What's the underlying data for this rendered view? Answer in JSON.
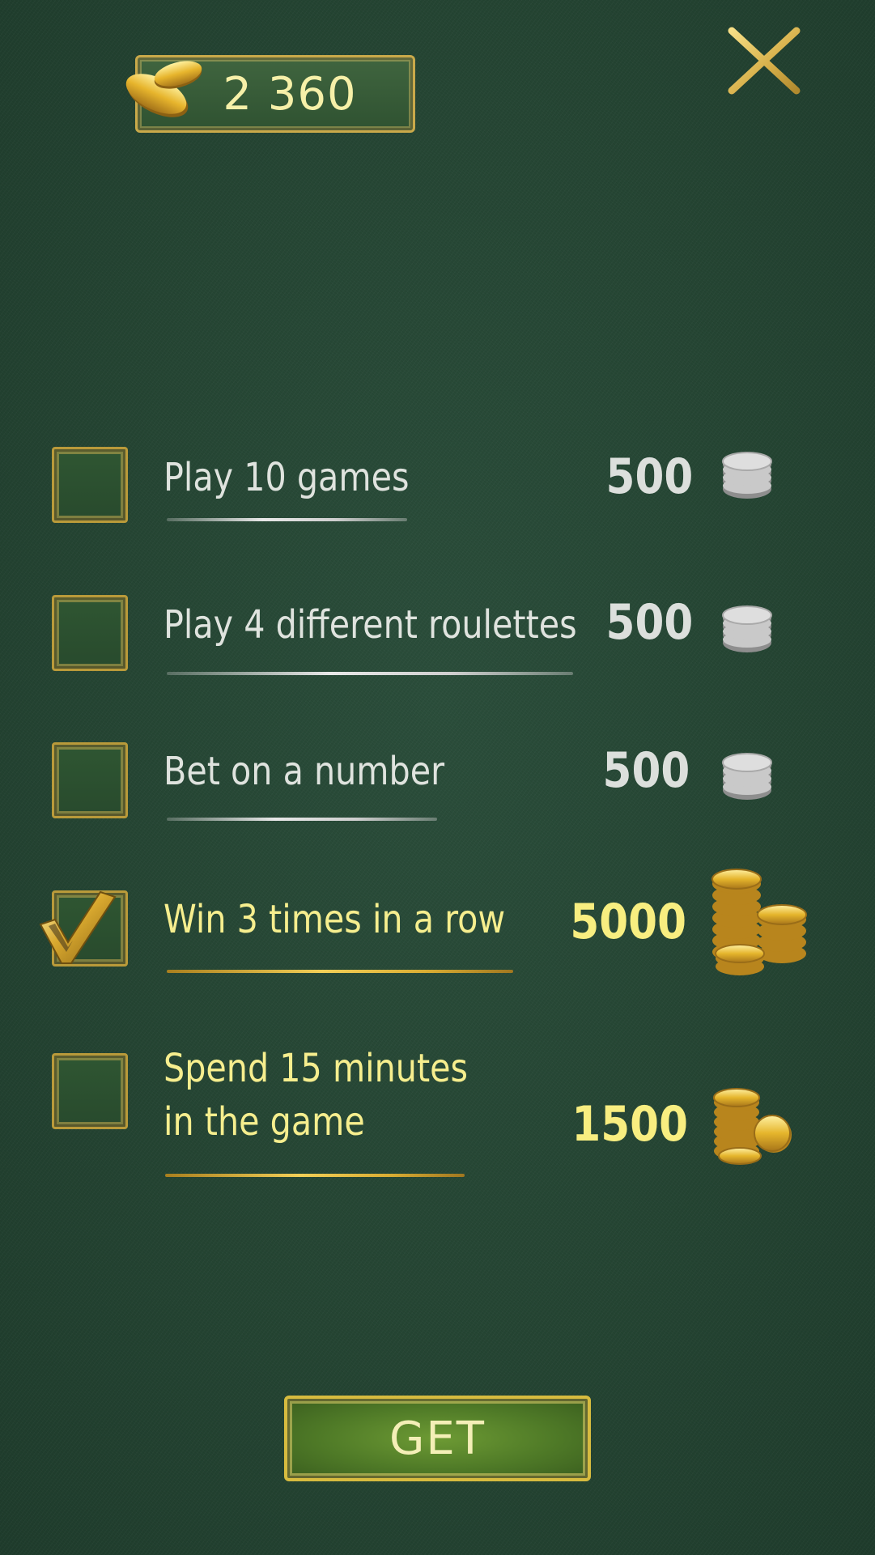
{
  "balance": {
    "value": "2 360",
    "icon": "gold-coins-icon"
  },
  "close": {
    "icon": "close-icon"
  },
  "quests": [
    {
      "label": "Play 10 games",
      "reward": "500",
      "reward_type": "silver",
      "completed": false
    },
    {
      "label": "Play 4 different roulettes",
      "reward": "500",
      "reward_type": "silver",
      "completed": false
    },
    {
      "label": "Bet on a number",
      "reward": "500",
      "reward_type": "silver",
      "completed": false
    },
    {
      "label": "Win 3 times in a row",
      "reward": "5000",
      "reward_type": "gold",
      "completed": true
    },
    {
      "label_line1": "Spend 15 minutes",
      "label_line2": "in the game",
      "reward": "1500",
      "reward_type": "gold",
      "completed": false
    }
  ],
  "get_button": {
    "label": "GET"
  },
  "colors": {
    "felt": "#274836",
    "gold": "#d7bb3f",
    "gold_text": "#f6ee8e",
    "silver_text": "#dfe3de"
  }
}
